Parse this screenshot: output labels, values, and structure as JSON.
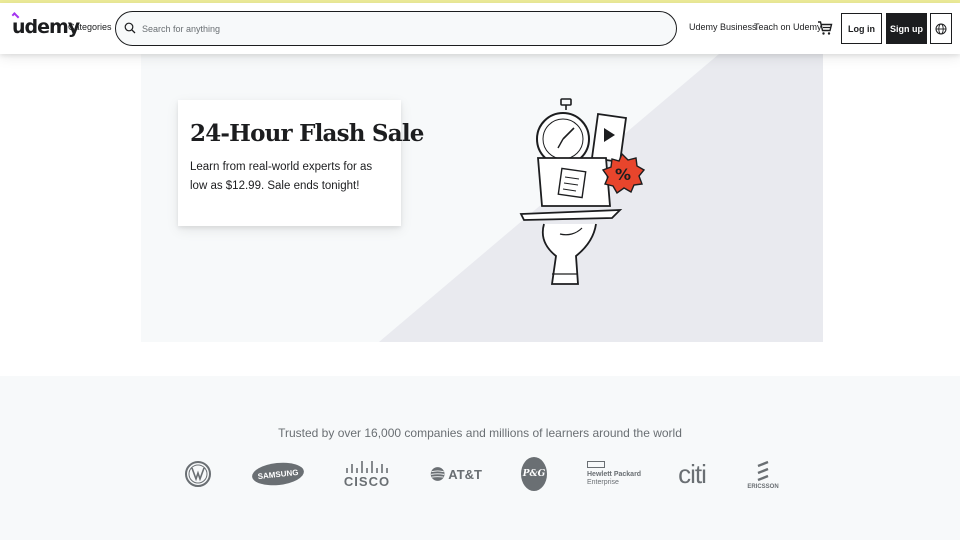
{
  "header": {
    "logo": "udemy",
    "categories": "Categories",
    "search_placeholder": "Search for anything",
    "business": "Udemy Business",
    "teach": "Teach on Udemy",
    "login": "Log in",
    "signup": "Sign up",
    "icons": {
      "search": "search-icon",
      "cart": "cart-icon",
      "language": "globe-icon"
    }
  },
  "hero": {
    "title": "24-Hour Flash Sale",
    "text": "Learn from real-world experts for as low as $12.99. Sale ends tonight!",
    "badge": "%"
  },
  "trusted": {
    "text": "Trusted by over 16,000 companies and millions of learners around the world",
    "logos": {
      "samsung": "SAMSUNG",
      "cisco": "CISCO",
      "att": "AT&T",
      "pg": "P&G",
      "hp_line1": "Hewlett Packard",
      "hp_line2": "Enterprise",
      "citi": "citi",
      "ericsson": "ERICSSON"
    }
  },
  "colors": {
    "accent_bar": "#eceb98",
    "brand_purple": "#a435f0",
    "badge_red": "#e8452c",
    "dark": "#1c1d1f"
  }
}
